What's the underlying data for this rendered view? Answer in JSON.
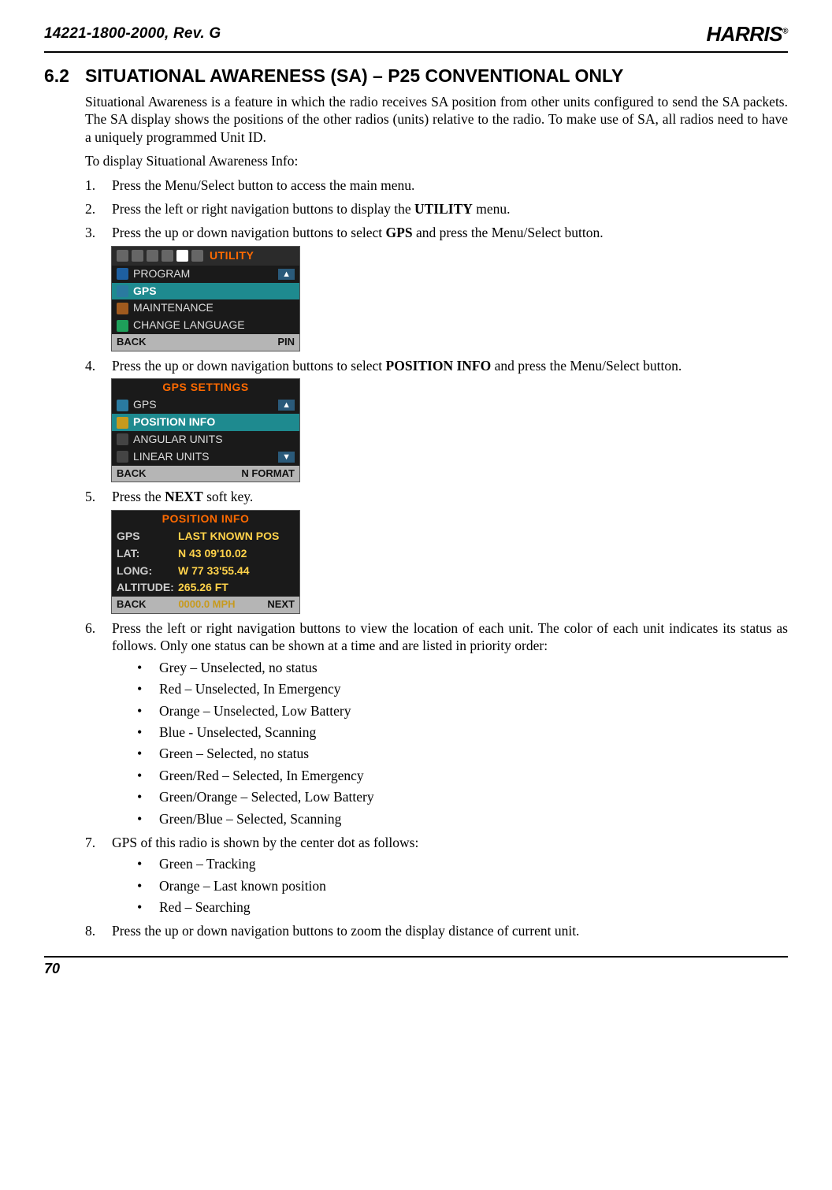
{
  "header": {
    "doc_id": "14221-1800-2000, Rev. G",
    "logo_text": "HARRIS"
  },
  "section": {
    "number": "6.2",
    "title": "SITUATIONAL AWARENESS (SA) – P25 CONVENTIONAL ONLY"
  },
  "intro": {
    "p1": "Situational Awareness is a feature in which the radio receives SA position from other units configured to send the SA packets. The SA display shows the positions of the other radios (units) relative to the radio. To make use of SA, all radios need to have a uniquely programmed Unit ID.",
    "p2": "To display Situational Awareness Info:"
  },
  "steps": {
    "s1": "Press the Menu/Select button to access the main menu.",
    "s2a": "Press the left or right navigation buttons to display the ",
    "s2b": "UTILITY",
    "s2c": " menu.",
    "s3a": "Press the up or down navigation buttons to select ",
    "s3b": "GPS",
    "s3c": " and press the Menu/Select button.",
    "s4a": "Press the up or down navigation buttons to select ",
    "s4b": "POSITION INFO",
    "s4c": " and press the Menu/Select button.",
    "s5a": "Press the ",
    "s5b": "NEXT",
    "s5c": " soft key.",
    "s6": "Press the left or right navigation buttons to view the location of each unit. The color of each unit indicates its status as follows. Only one status can be shown at a time and are listed in priority order:",
    "s7": "GPS of this radio is shown by the center dot as follows:",
    "s8": "Press the up or down navigation buttons to zoom the display distance of current unit."
  },
  "status_list": [
    "Grey – Unselected, no status",
    "Red – Unselected, In Emergency",
    "Orange – Unselected, Low Battery",
    "Blue - Unselected, Scanning",
    "Green – Selected, no status",
    "Green/Red – Selected, In Emergency",
    "Green/Orange – Selected, Low Battery",
    "Green/Blue – Selected, Scanning"
  ],
  "gps_list": [
    "Green – Tracking",
    "Orange – Last known position",
    "Red – Searching"
  ],
  "radio1": {
    "tab": "UTILITY",
    "items": [
      "PROGRAM",
      "GPS",
      "MAINTENANCE",
      "CHANGE LANGUAGE"
    ],
    "soft_left": "BACK",
    "soft_right": "PIN"
  },
  "radio2": {
    "tab": "GPS SETTINGS",
    "items": [
      "GPS",
      "POSITION INFO",
      "ANGULAR UNITS",
      "LINEAR UNITS"
    ],
    "soft_left": "BACK",
    "soft_right": "N FORMAT"
  },
  "radio3": {
    "tab": "POSITION INFO",
    "rows": [
      {
        "lbl": "GPS",
        "val": "LAST KNOWN POS"
      },
      {
        "lbl": "LAT:",
        "val": "N 43 09'10.02"
      },
      {
        "lbl": "LONG:",
        "val": "W 77 33'55.44"
      },
      {
        "lbl": "ALTITUDE:",
        "val": "265.26 FT"
      }
    ],
    "speed": "0000.0 MPH",
    "soft_left": "BACK",
    "soft_right": "NEXT"
  },
  "footer": {
    "page": "70"
  }
}
